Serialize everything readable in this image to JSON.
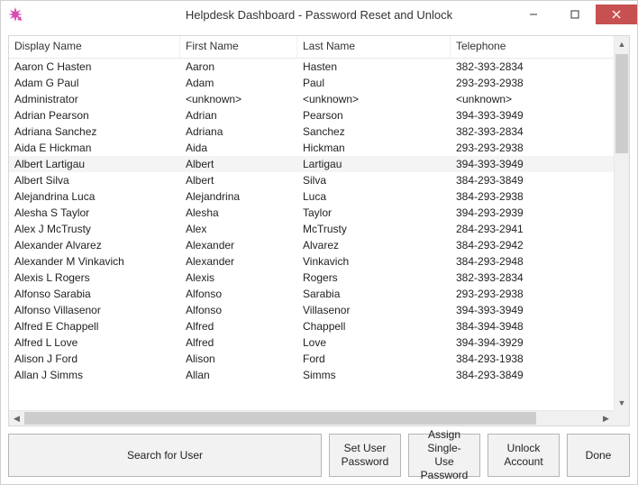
{
  "window": {
    "title": "Helpdesk Dashboard - Password Reset and Unlock"
  },
  "table": {
    "columns": [
      "Display Name",
      "First Name",
      "Last Name",
      "Telephone"
    ],
    "selectedIndex": 6,
    "rows": [
      {
        "dn": "Aaron C Hasten",
        "fn": "Aaron",
        "ln": "Hasten",
        "tel": "382-393-2834"
      },
      {
        "dn": "Adam G Paul",
        "fn": "Adam",
        "ln": "Paul",
        "tel": "293-293-2938"
      },
      {
        "dn": "Administrator",
        "fn": "<unknown>",
        "ln": "<unknown>",
        "tel": "<unknown>"
      },
      {
        "dn": "Adrian Pearson",
        "fn": "Adrian",
        "ln": "Pearson",
        "tel": "394-393-3949"
      },
      {
        "dn": "Adriana Sanchez",
        "fn": "Adriana",
        "ln": "Sanchez",
        "tel": "382-393-2834"
      },
      {
        "dn": "Aida E Hickman",
        "fn": "Aida",
        "ln": "Hickman",
        "tel": "293-293-2938"
      },
      {
        "dn": "Albert Lartigau",
        "fn": "Albert",
        "ln": "Lartigau",
        "tel": "394-393-3949"
      },
      {
        "dn": "Albert Silva",
        "fn": "Albert",
        "ln": "Silva",
        "tel": "384-293-3849"
      },
      {
        "dn": "Alejandrina Luca",
        "fn": "Alejandrina",
        "ln": "Luca",
        "tel": "384-293-2938"
      },
      {
        "dn": "Alesha S Taylor",
        "fn": "Alesha",
        "ln": "Taylor",
        "tel": "394-293-2939"
      },
      {
        "dn": "Alex J McTrusty",
        "fn": "Alex",
        "ln": "McTrusty",
        "tel": "284-293-2941"
      },
      {
        "dn": "Alexander Alvarez",
        "fn": "Alexander",
        "ln": "Alvarez",
        "tel": "384-293-2942"
      },
      {
        "dn": "Alexander M Vinkavich",
        "fn": "Alexander",
        "ln": "Vinkavich",
        "tel": "384-293-2948"
      },
      {
        "dn": "Alexis L Rogers",
        "fn": "Alexis",
        "ln": "Rogers",
        "tel": "382-393-2834"
      },
      {
        "dn": "Alfonso Sarabia",
        "fn": "Alfonso",
        "ln": "Sarabia",
        "tel": "293-293-2938"
      },
      {
        "dn": "Alfonso Villasenor",
        "fn": "Alfonso",
        "ln": "Villasenor",
        "tel": "394-393-3949"
      },
      {
        "dn": "Alfred E Chappell",
        "fn": "Alfred",
        "ln": "Chappell",
        "tel": "384-394-3948"
      },
      {
        "dn": "Alfred L Love",
        "fn": "Alfred",
        "ln": "Love",
        "tel": "394-394-3929"
      },
      {
        "dn": "Alison J Ford",
        "fn": "Alison",
        "ln": "Ford",
        "tel": "384-293-1938"
      },
      {
        "dn": "Allan J Simms",
        "fn": "Allan",
        "ln": "Simms",
        "tel": "384-293-3849"
      }
    ]
  },
  "buttons": {
    "search": "Search for User",
    "set_password": "Set User Password",
    "assign_single_use": "Assign Single-Use Password",
    "unlock": "Unlock Account",
    "done": "Done"
  }
}
